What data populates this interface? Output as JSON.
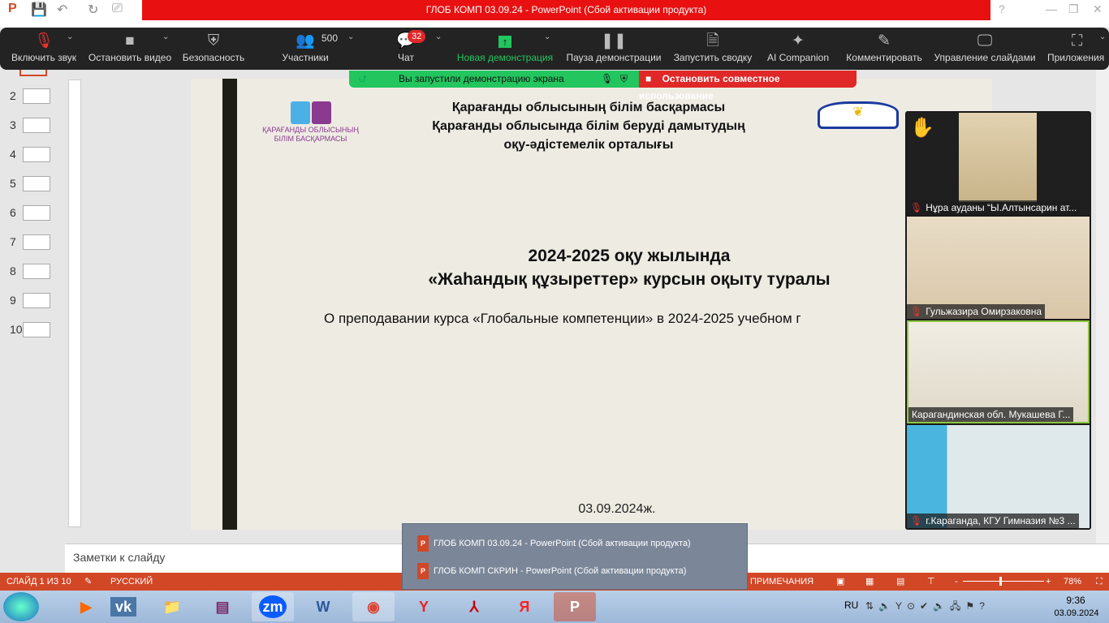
{
  "window": {
    "title": "ГЛОБ КОМП 03.09.24 -  PowerPoint (Сбой активации продукта)",
    "help": "?",
    "minimize": "—",
    "restore": "❐",
    "close": "✕"
  },
  "zoom_toolbar": {
    "items": [
      {
        "label": "Включить звук",
        "icon": "mic-muted-icon"
      },
      {
        "label": "Остановить видео",
        "icon": "video-icon"
      },
      {
        "label": "Безопасность",
        "icon": "shield-icon"
      },
      {
        "label": "Участники",
        "icon": "participants-icon",
        "count": "500"
      },
      {
        "label": "Чат",
        "icon": "chat-icon",
        "badge": "32"
      },
      {
        "label": "Новая демонстрация",
        "icon": "share-screen-icon",
        "color": "#22c55e"
      },
      {
        "label": "Пауза демонстрации",
        "icon": "pause-icon"
      },
      {
        "label": "Запустить сводку",
        "icon": "summary-icon"
      },
      {
        "label": "AI Companion",
        "icon": "sparkle-icon"
      },
      {
        "label": "Комментировать",
        "icon": "pencil-icon"
      },
      {
        "label": "Управление слайдами",
        "icon": "slides-control-icon"
      },
      {
        "label": "Приложения",
        "icon": "apps-icon"
      }
    ]
  },
  "share_banner": {
    "status": "Вы запустили демонстрацию экрана",
    "stop": "Остановить совместное использование"
  },
  "thumbnails": [
    "2",
    "3",
    "4",
    "5",
    "6",
    "7",
    "8",
    "9",
    "10"
  ],
  "slide": {
    "logo_text_1": "ҚАРАҒАНДЫ ОБЛЫСЫНЫҢ",
    "logo_text_2": "БІЛІМ БАСҚАРМАСЫ",
    "header_1": "Қарағанды облысының білім басқармасы",
    "header_2": "Қарағанды облысында білім беруді дамытудың",
    "header_3": "оқу-әдістемелік орталығы",
    "title_1": "2024-2025 оқу жылында",
    "title_2": "«Жаһандық құзыреттер» курсын оқыту туралы",
    "subtitle": "О преподавании курса «Глобальные компетенции» в 2024-2025 учебном г",
    "date": "03.09.2024ж."
  },
  "participants": [
    {
      "name": "Нұра ауданы “Ы.Алтынсарин ат...",
      "hand_raised": true
    },
    {
      "name": "Гульжазира Омирзаковна"
    },
    {
      "name": "Карагандинская обл. Мукашева Г...",
      "active_speaker": true
    },
    {
      "name": "г.Караганда, КГУ Гимназия №3 ..."
    }
  ],
  "notes_placeholder": "Заметки к слайду",
  "status_bar": {
    "slide": "СЛАЙД 1 ИЗ 10",
    "language": "РУССКИЙ",
    "notes": "ПРИМЕЧАНИЯ",
    "zoom": "78%",
    "zoom_percent": 78
  },
  "taskbar_popup": [
    "ГЛОБ КОМП 03.09.24 - PowerPoint (Сбой активации продукта)",
    "ГЛОБ КОМП СКРИН - PowerPoint (Сбой активации продукта)"
  ],
  "taskbar": {
    "apps": [
      "start",
      "media-player",
      "vk",
      "explorer",
      "winrar",
      "zoom",
      "word",
      "chrome",
      "yandex-browser",
      "acrobat",
      "yandex",
      "powerpoint"
    ],
    "lang": "RU",
    "time": "9:36",
    "date": "03.09.2024"
  }
}
